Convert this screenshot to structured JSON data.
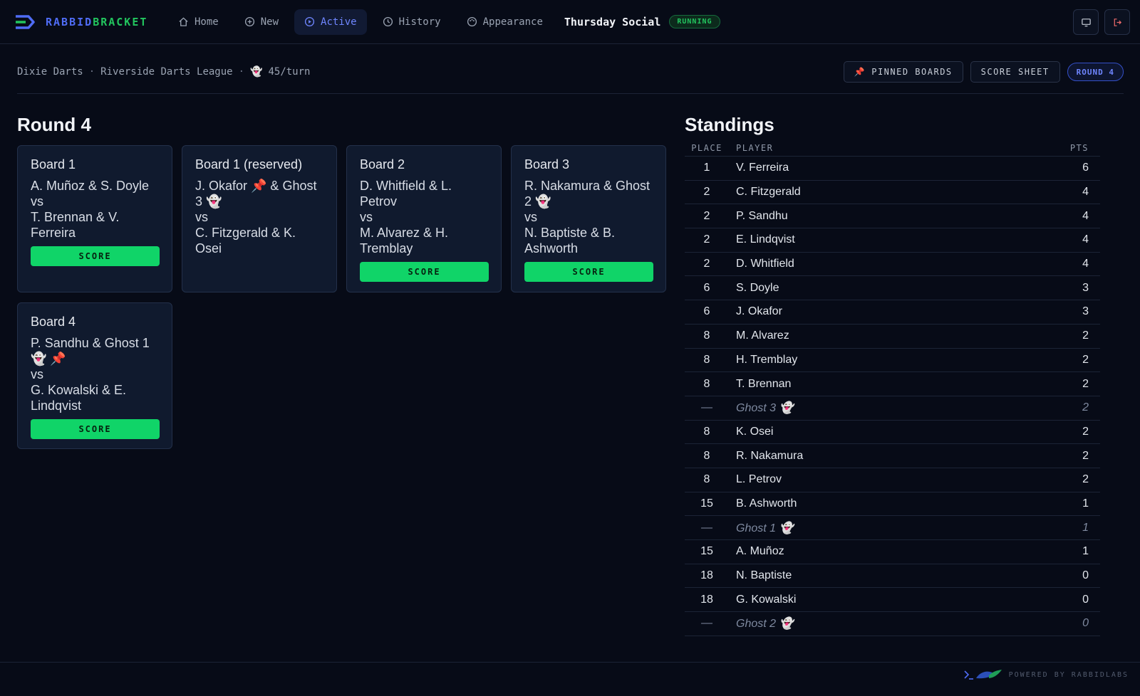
{
  "brand": {
    "part1": "RABBID",
    "part2": "BRACKET"
  },
  "nav": [
    {
      "label": "Home",
      "icon": "home-icon"
    },
    {
      "label": "New",
      "icon": "plus-circle-icon"
    },
    {
      "label": "Active",
      "icon": "play-circle-icon",
      "active": true
    },
    {
      "label": "History",
      "icon": "clock-icon"
    },
    {
      "label": "Appearance",
      "icon": "palette-icon"
    }
  ],
  "event": {
    "title": "Thursday Social",
    "status": "RUNNING"
  },
  "breadcrumb": {
    "venue": "Dixie Darts",
    "league": "Riverside Darts League",
    "sep": "·",
    "ghost_rate": "45/turn"
  },
  "actions": {
    "pinned": "PINNED BOARDS",
    "score_sheet": "SCORE SHEET",
    "round": "ROUND 4"
  },
  "round": {
    "title": "Round 4",
    "score_label": "SCORE",
    "boards": [
      {
        "title": "Board 1",
        "lines": [
          "A. Muñoz & S. Doyle",
          "vs",
          "T. Brennan & V.",
          "Ferreira"
        ],
        "scorable": true
      },
      {
        "title": "Board 1 (reserved)",
        "lines": [
          "J. Okafor 📌 & Ghost",
          "3 👻",
          "vs",
          "C. Fitzgerald & K.",
          "Osei"
        ],
        "scorable": false
      },
      {
        "title": "Board 2",
        "lines": [
          "D. Whitfield & L.",
          "Petrov",
          "vs",
          "M. Alvarez & H.",
          "Tremblay"
        ],
        "scorable": true
      },
      {
        "title": "Board 3",
        "lines": [
          "R. Nakamura & Ghost",
          "2 👻",
          "vs",
          "N. Baptiste & B.",
          "Ashworth"
        ],
        "scorable": true
      },
      {
        "title": "Board 4",
        "lines": [
          "P. Sandhu & Ghost 1",
          "👻 📌",
          "vs",
          "G. Kowalski & E.",
          "Lindqvist"
        ],
        "scorable": true
      }
    ]
  },
  "standings": {
    "title": "Standings",
    "headers": {
      "place": "PLACE",
      "player": "PLAYER",
      "pts": "PTS"
    },
    "rows": [
      {
        "place": "1",
        "player": "V. Ferreira",
        "pts": "6"
      },
      {
        "place": "2",
        "player": "C. Fitzgerald",
        "pts": "4"
      },
      {
        "place": "2",
        "player": "P. Sandhu",
        "pts": "4"
      },
      {
        "place": "2",
        "player": "E. Lindqvist",
        "pts": "4"
      },
      {
        "place": "2",
        "player": "D. Whitfield",
        "pts": "4"
      },
      {
        "place": "6",
        "player": "S. Doyle",
        "pts": "3"
      },
      {
        "place": "6",
        "player": "J. Okafor",
        "pts": "3"
      },
      {
        "place": "8",
        "player": "M. Alvarez",
        "pts": "2"
      },
      {
        "place": "8",
        "player": "H. Tremblay",
        "pts": "2"
      },
      {
        "place": "8",
        "player": "T. Brennan",
        "pts": "2"
      },
      {
        "place": "—",
        "player": "Ghost 3 👻",
        "pts": "2",
        "ghost": true
      },
      {
        "place": "8",
        "player": "K. Osei",
        "pts": "2"
      },
      {
        "place": "8",
        "player": "R. Nakamura",
        "pts": "2"
      },
      {
        "place": "8",
        "player": "L. Petrov",
        "pts": "2"
      },
      {
        "place": "15",
        "player": "B. Ashworth",
        "pts": "1"
      },
      {
        "place": "—",
        "player": "Ghost 1 👻",
        "pts": "1",
        "ghost": true
      },
      {
        "place": "15",
        "player": "A. Muñoz",
        "pts": "1"
      },
      {
        "place": "18",
        "player": "N. Baptiste",
        "pts": "0"
      },
      {
        "place": "18",
        "player": "G. Kowalski",
        "pts": "0"
      },
      {
        "place": "—",
        "player": "Ghost 2 👻",
        "pts": "0",
        "ghost": true
      }
    ]
  },
  "footer": {
    "powered": "POWERED BY RABBIDLABS"
  },
  "colors": {
    "accent": "#4f6cf5",
    "success": "#22c55e",
    "score_button": "#10d468",
    "background": "#070b17"
  }
}
